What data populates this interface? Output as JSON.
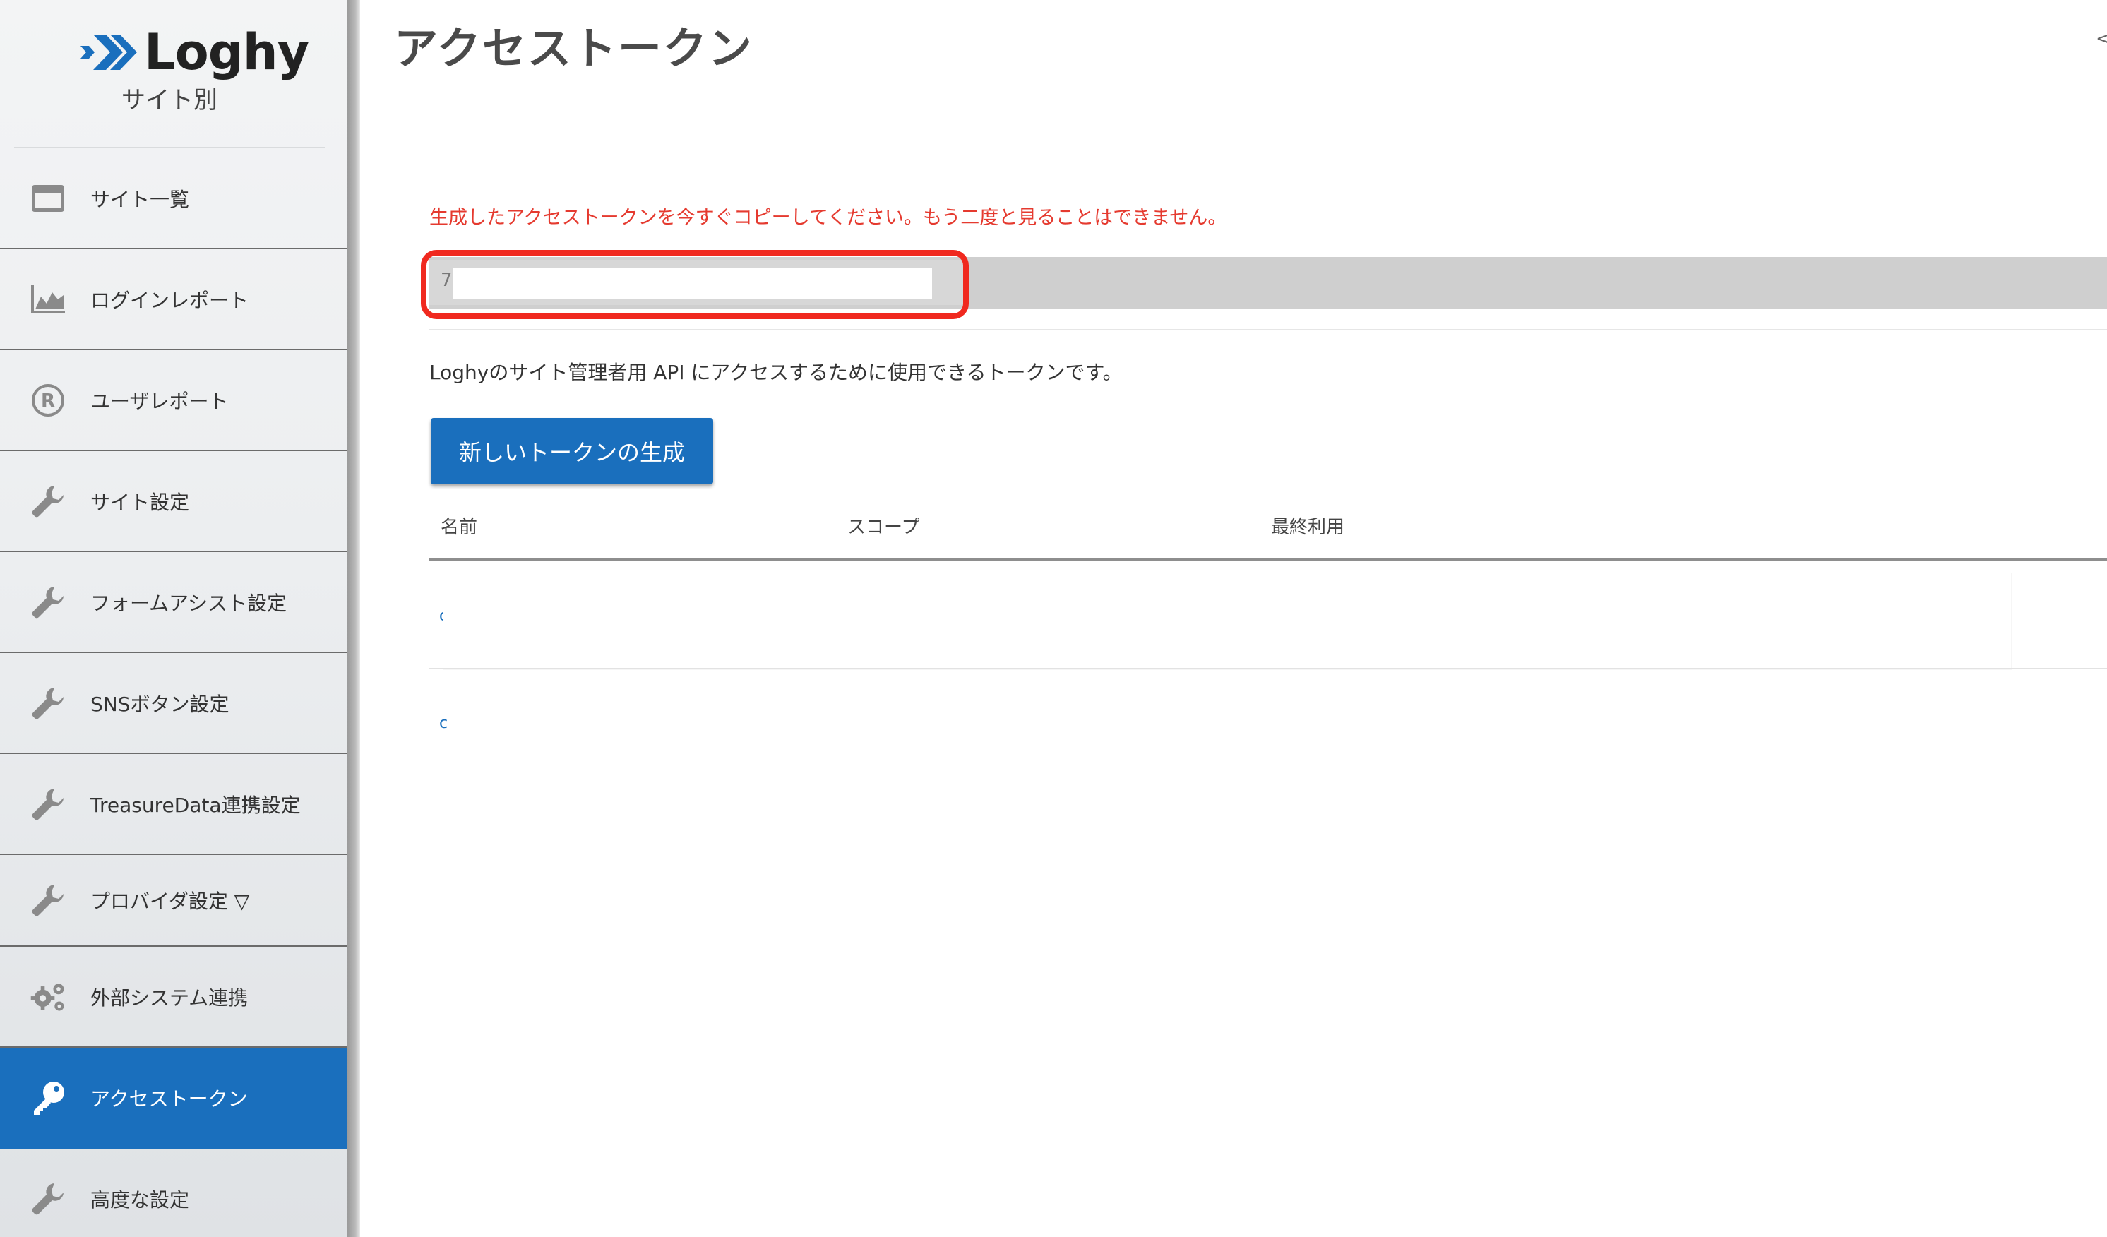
{
  "brand": {
    "logo_text": "Loghy",
    "site_label": "サイト別",
    "accent_color": "#1a6fbd"
  },
  "sidebar": {
    "items": [
      {
        "label": "サイト一覧",
        "icon": "window-icon",
        "active": false
      },
      {
        "label": "ログインレポート",
        "icon": "area-chart-icon",
        "active": false
      },
      {
        "label": "ユーザレポート",
        "icon": "registered-icon",
        "active": false
      },
      {
        "label": "サイト設定",
        "icon": "wrench-icon",
        "active": false
      },
      {
        "label": "フォームアシスト設定",
        "icon": "wrench-icon",
        "active": false
      },
      {
        "label": "SNSボタン設定",
        "icon": "wrench-icon",
        "active": false
      },
      {
        "label": "TreasureData連携設定",
        "icon": "wrench-icon",
        "active": false
      },
      {
        "label": "プロバイダ設定 ▽",
        "icon": "wrench-icon",
        "active": false
      },
      {
        "label": "外部システム連携",
        "icon": "gears-icon",
        "active": false
      },
      {
        "label": "アクセストークン",
        "icon": "key-icon",
        "active": true
      },
      {
        "label": "高度な設定",
        "icon": "wrench-icon",
        "active": false
      }
    ]
  },
  "main": {
    "title": "アクセストークン",
    "corner_glyph": "<",
    "warning": "生成したアクセストークンを今すぐコピーしてください。もう二度と見ることはできません。",
    "token": {
      "visible_prefix": "7"
    },
    "description": "Loghyのサイト管理者用 API にアクセスするために使用できるトークンです。",
    "new_token_button": "新しいトークンの生成",
    "table": {
      "columns": [
        "名前",
        "スコープ",
        "最終利用"
      ],
      "row_markers": [
        "c",
        "c"
      ]
    },
    "warning_color": "#e53a2f",
    "highlight_color": "#f0291f"
  }
}
